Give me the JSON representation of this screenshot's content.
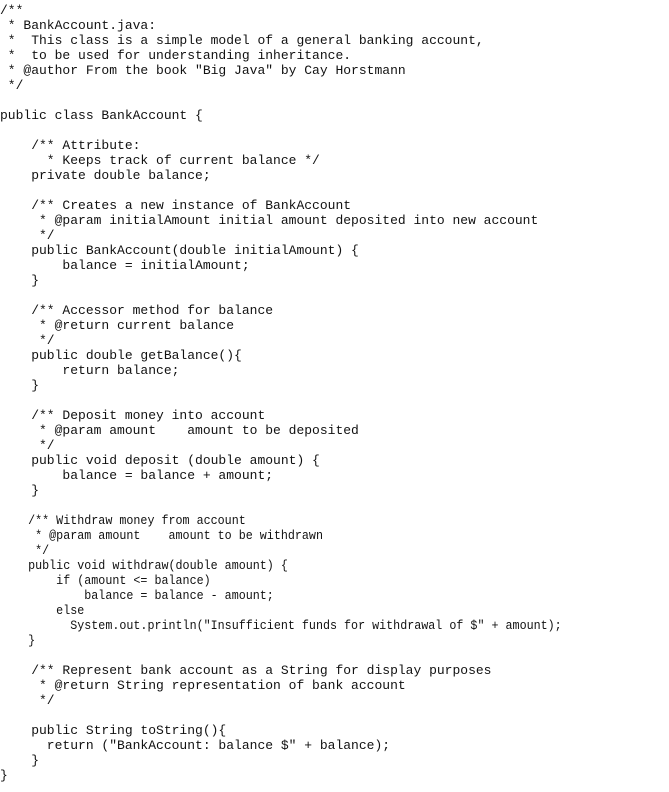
{
  "document": {
    "file_name": "BankAccount.java",
    "language": "java",
    "lines": [
      {
        "text": "/**"
      },
      {
        "text": " * BankAccount.java:"
      },
      {
        "text": " *  This class is a simple model of a general banking account,"
      },
      {
        "text": " *  to be used for understanding inheritance."
      },
      {
        "text": " * @author From the book \"Big Java\" by Cay Horstmann"
      },
      {
        "text": " */"
      },
      {
        "text": ""
      },
      {
        "text": "public class BankAccount {"
      },
      {
        "text": ""
      },
      {
        "text": "    /** Attribute:"
      },
      {
        "text": "      * Keeps track of current balance */"
      },
      {
        "text": "    private double balance;"
      },
      {
        "text": ""
      },
      {
        "text": "    /** Creates a new instance of BankAccount"
      },
      {
        "text": "     * @param initialAmount initial amount deposited into new account"
      },
      {
        "text": "     */"
      },
      {
        "text": "    public BankAccount(double initialAmount) {"
      },
      {
        "text": "        balance = initialAmount;"
      },
      {
        "text": "    }"
      },
      {
        "text": ""
      },
      {
        "text": "    /** Accessor method for balance"
      },
      {
        "text": "     * @return current balance"
      },
      {
        "text": "     */"
      },
      {
        "text": "    public double getBalance(){"
      },
      {
        "text": "        return balance;"
      },
      {
        "text": "    }"
      },
      {
        "text": ""
      },
      {
        "text": "    /** Deposit money into account"
      },
      {
        "text": "     * @param amount    amount to be deposited"
      },
      {
        "text": "     */"
      },
      {
        "text": "    public void deposit (double amount) {"
      },
      {
        "text": "        balance = balance + amount;"
      },
      {
        "text": "    }"
      },
      {
        "text": ""
      },
      {
        "text": "    /** Withdraw money from account",
        "condensed": true
      },
      {
        "text": "     * @param amount    amount to be withdrawn",
        "condensed": true
      },
      {
        "text": "     */",
        "condensed": true
      },
      {
        "text": "    public void withdraw(double amount) {",
        "condensed": true
      },
      {
        "text": "        if (amount <= balance)",
        "condensed": true
      },
      {
        "text": "            balance = balance - amount;",
        "condensed": true
      },
      {
        "text": "        else",
        "condensed": true
      },
      {
        "text": "          System.out.println(\"Insufficient funds for withdrawal of $\" + amount);",
        "condensed": true
      },
      {
        "text": "    }",
        "condensed": true
      },
      {
        "text": ""
      },
      {
        "text": "    /** Represent bank account as a String for display purposes"
      },
      {
        "text": "     * @return String representation of bank account"
      },
      {
        "text": "     */"
      },
      {
        "text": ""
      },
      {
        "text": "    public String toString(){"
      },
      {
        "text": "      return (\"BankAccount: balance $\" + balance);"
      },
      {
        "text": "    }"
      },
      {
        "text": "}"
      }
    ]
  }
}
